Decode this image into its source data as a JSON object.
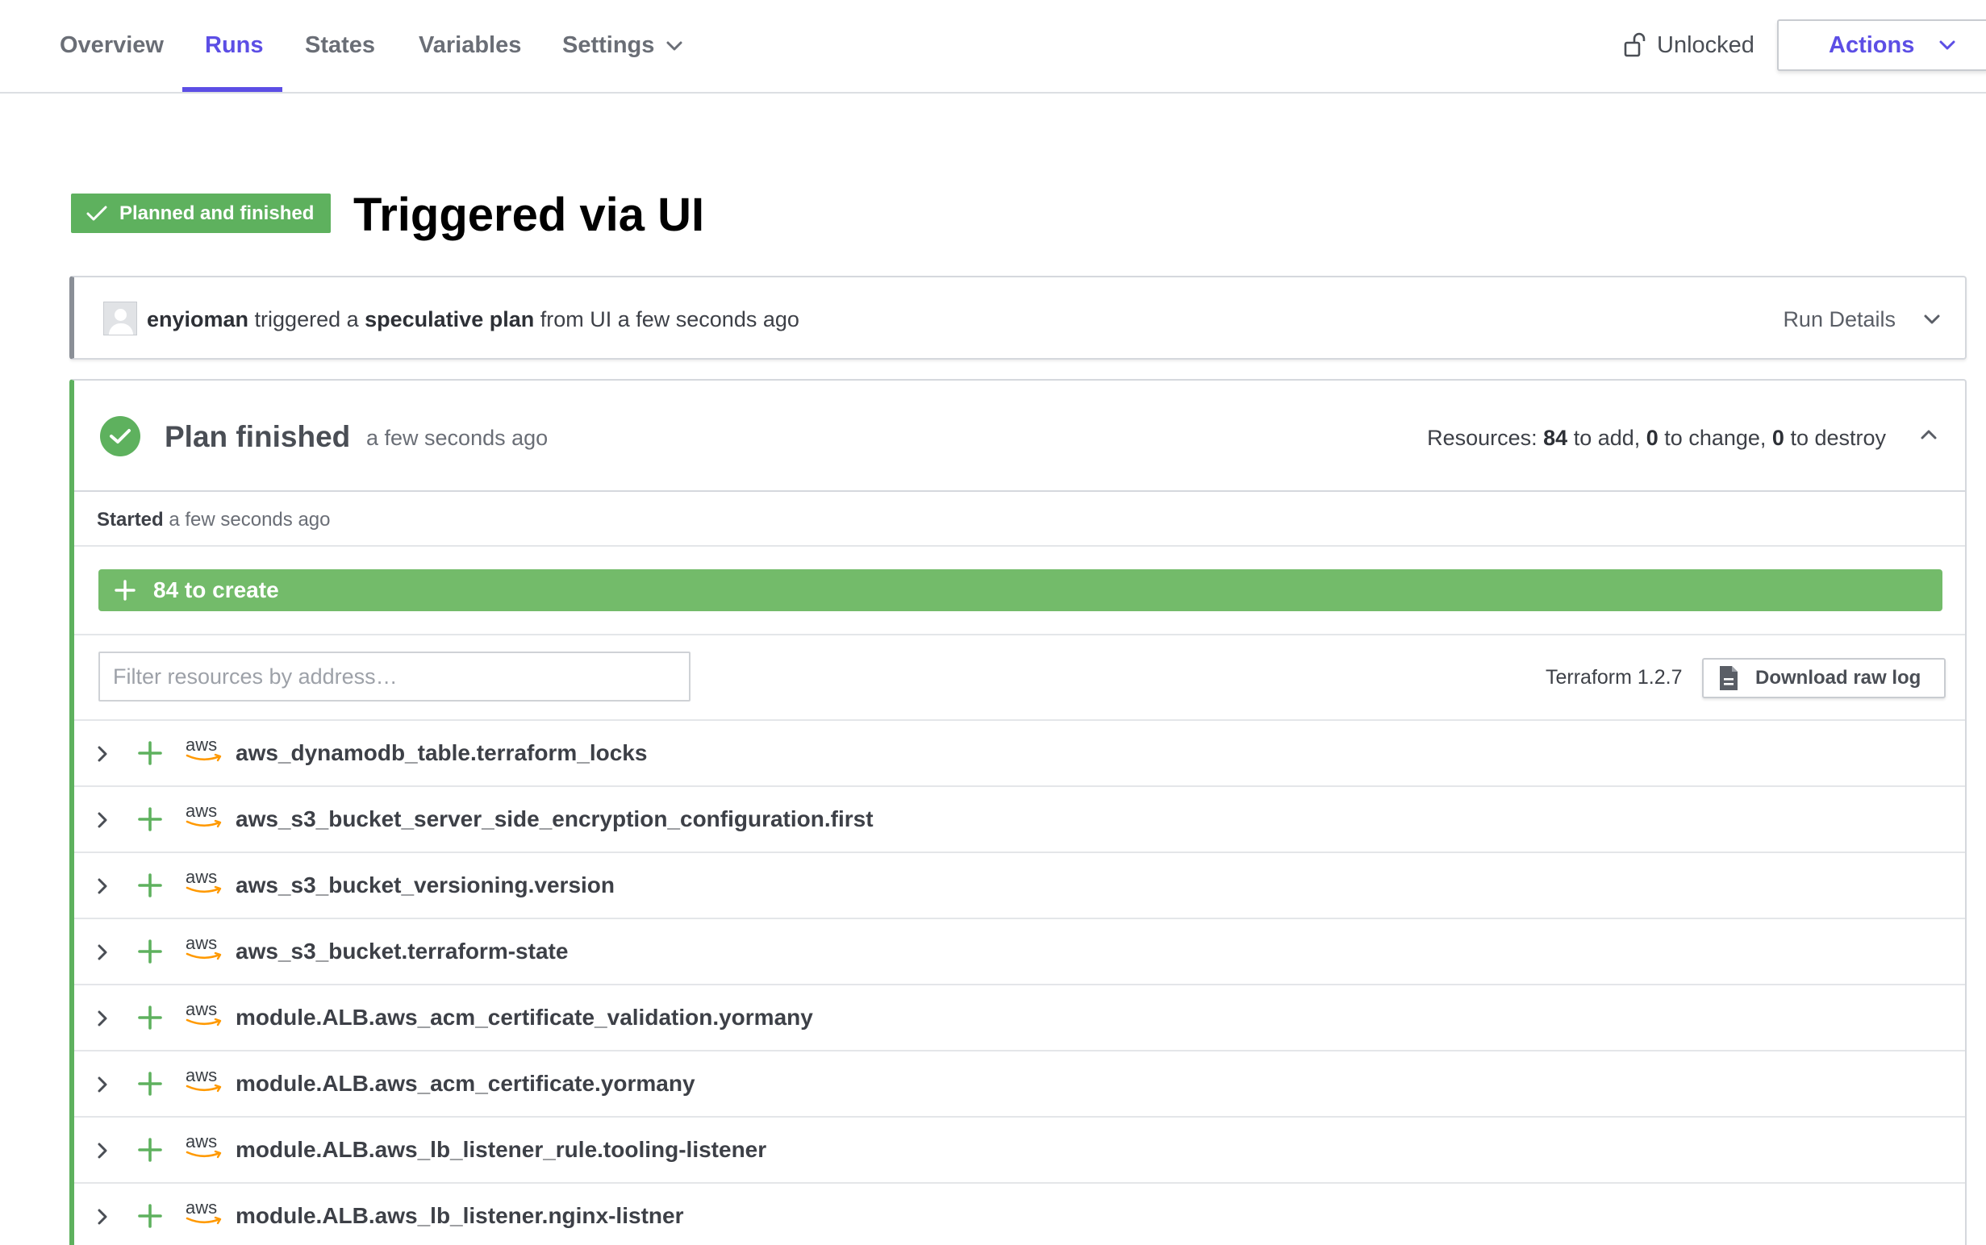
{
  "nav": {
    "tabs": [
      {
        "label": "Overview"
      },
      {
        "label": "Runs"
      },
      {
        "label": "States"
      },
      {
        "label": "Variables"
      },
      {
        "label": "Settings"
      }
    ],
    "active_tab": "Runs",
    "lock_label": "Unlocked",
    "actions_label": "Actions"
  },
  "run": {
    "status_badge": "Planned and finished",
    "title": "Triggered via UI",
    "trigger": {
      "user": "enyioman",
      "text_triggered": " triggered a ",
      "plan_type": "speculative plan",
      "text_from": " from UI a few seconds ago"
    },
    "run_details_label": "Run Details"
  },
  "plan": {
    "title": "Plan finished",
    "time": "a few seconds ago",
    "resources": {
      "prefix": "Resources: ",
      "add": "84",
      "add_label": " to add, ",
      "change": "0",
      "change_label": " to change, ",
      "destroy": "0",
      "destroy_label": " to destroy"
    },
    "started_label": "Started",
    "started_time": " a few seconds ago",
    "create_summary": "84 to create",
    "filter_placeholder": "Filter resources by address…",
    "terraform_version": "Terraform 1.2.7",
    "download_label": "Download raw log",
    "provider_logo": "aws",
    "resources_list": [
      "aws_dynamodb_table.terraform_locks",
      "aws_s3_bucket_server_side_encryption_configuration.first",
      "aws_s3_bucket_versioning.version",
      "aws_s3_bucket.terraform-state",
      "module.ALB.aws_acm_certificate_validation.yormany",
      "module.ALB.aws_acm_certificate.yormany",
      "module.ALB.aws_lb_listener_rule.tooling-listener",
      "module.ALB.aws_lb_listener.nginx-listner"
    ]
  },
  "colors": {
    "accent": "#5c4ee5",
    "success": "#5eb15e",
    "create_bar": "#73bb6a",
    "aws_orange": "#ff9900"
  },
  "icons": [
    "chevron-down-icon",
    "unlock-icon",
    "checkmark-icon",
    "check-circle-icon",
    "chevron-up-icon",
    "plus-icon",
    "document-icon",
    "chevron-right-icon",
    "aws-logo"
  ]
}
